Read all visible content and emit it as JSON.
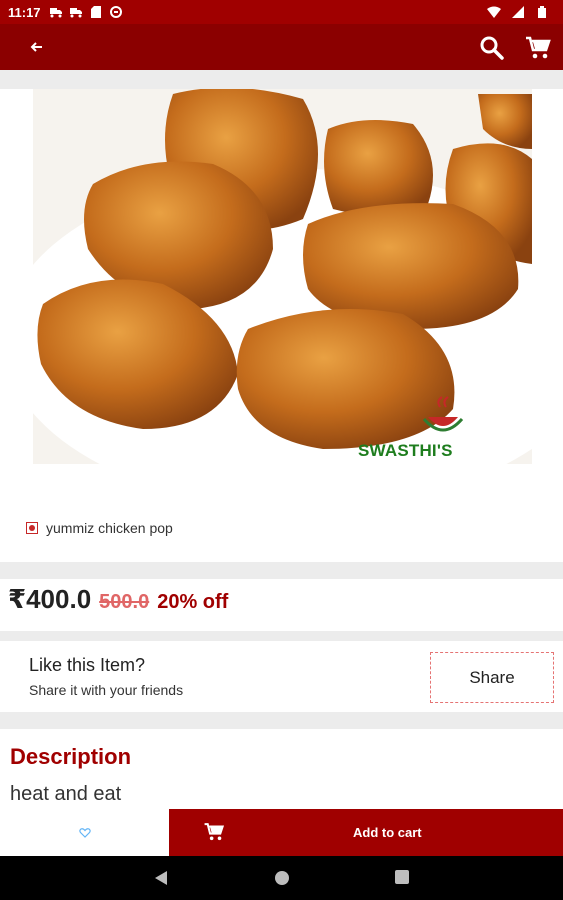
{
  "status_bar": {
    "time": "11:17"
  },
  "app_bar": {
    "back_icon": "arrow-left-icon",
    "search_icon": "search-icon",
    "cart_icon": "cart-icon"
  },
  "product": {
    "image_watermark": "SWASTHI'S RECIPES",
    "name": "yummiz chicken pop",
    "price": "₹400.0",
    "mrp": "500.0",
    "discount": "20% off"
  },
  "share": {
    "title": "Like this Item?",
    "subtitle": "Share it with your friends",
    "button_label": "Share"
  },
  "description": {
    "heading": "Description",
    "text": "heat and eat"
  },
  "bottom_bar": {
    "add_to_cart_label": "Add to cart",
    "wishlist_icon": "heart-icon"
  },
  "colors": {
    "primary": "#8b0000",
    "accent": "#a00000",
    "strike": "#e06666"
  }
}
